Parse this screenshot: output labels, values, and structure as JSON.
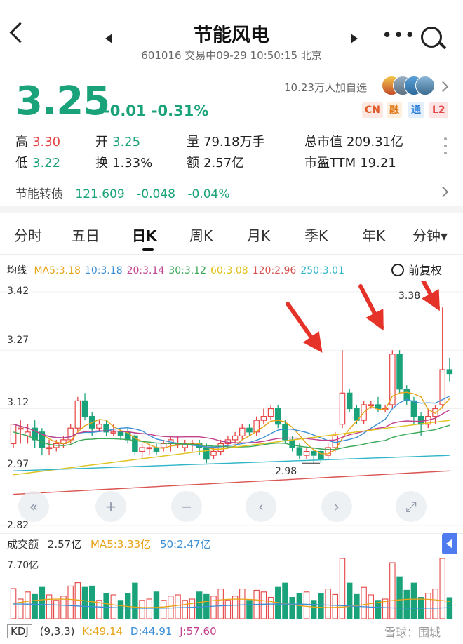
{
  "header": {
    "title": "节能风电",
    "subtitle": "601016 交易中09-29 10:50:15 北京",
    "more": "•••"
  },
  "quote": {
    "price": "3.25",
    "change": "-0.01 -0.31%",
    "follow_text": "10.23万人加自选",
    "badges": [
      "CN",
      "融",
      "通",
      "L2"
    ]
  },
  "stats": {
    "high_label": "高",
    "high": "3.30",
    "open_label": "开",
    "open": "3.25",
    "volume_label": "量",
    "volume": "79.18万手",
    "mcap_label": "总市值",
    "mcap": "209.31亿",
    "low_label": "低",
    "low": "3.22",
    "turnover_label": "换",
    "turnover": "1.33%",
    "amount_label": "额",
    "amount": "2.57亿",
    "pe_label": "市盈TTM",
    "pe": "19.21"
  },
  "bond": {
    "name": "节能转债",
    "price": "121.609",
    "change": "-0.048",
    "pct": "-0.04%"
  },
  "tabs": [
    "分时",
    "五日",
    "日K",
    "周K",
    "月K",
    "季K",
    "年K",
    "分钟▾"
  ],
  "ma_line": {
    "label": "均线",
    "items": [
      {
        "text": "MA5:3.18",
        "color": "#e8a317"
      },
      {
        "text": "10:3.18",
        "color": "#3b8fd6"
      },
      {
        "text": "20:3.14",
        "color": "#c2418f"
      },
      {
        "text": "30:3.12",
        "color": "#3aa857"
      },
      {
        "text": "60:3.08",
        "color": "#e0c21a"
      },
      {
        "text": "120:2.96",
        "color": "#d9534f"
      },
      {
        "text": "250:3.01",
        "color": "#30b5c8"
      }
    ],
    "restore": "前复权"
  },
  "chart_data": {
    "type": "candlestick",
    "y_ticks": [
      "3.42",
      "3.27",
      "3.12",
      "2.97",
      "2.82"
    ],
    "ylim": [
      2.82,
      3.42
    ],
    "annot_high": "3.38",
    "annot_low": "2.98",
    "candles": [
      [
        3.03,
        3.08,
        3.08,
        3.02
      ],
      [
        3.07,
        3.07,
        3.09,
        3.03
      ],
      [
        3.05,
        3.06,
        3.08,
        3.03
      ],
      [
        3.07,
        3.04,
        3.09,
        3.02
      ],
      [
        3.06,
        3.02,
        3.07,
        3.0
      ],
      [
        3.02,
        3.02,
        3.04,
        3.0
      ],
      [
        3.02,
        3.03,
        3.04,
        3.01
      ],
      [
        3.03,
        3.04,
        3.05,
        3.02
      ],
      [
        3.04,
        3.07,
        3.08,
        3.03
      ],
      [
        3.07,
        3.14,
        3.15,
        3.06
      ],
      [
        3.14,
        3.1,
        3.16,
        3.09
      ],
      [
        3.1,
        3.07,
        3.11,
        3.05
      ],
      [
        3.07,
        3.08,
        3.09,
        3.06
      ],
      [
        3.08,
        3.06,
        3.09,
        3.05
      ],
      [
        3.06,
        3.06,
        3.08,
        3.05
      ],
      [
        3.06,
        3.05,
        3.07,
        3.04
      ],
      [
        3.06,
        3.04,
        3.07,
        3.03
      ],
      [
        3.05,
        3.01,
        3.06,
        3.0
      ],
      [
        3.01,
        3.02,
        3.03,
        2.99
      ],
      [
        3.02,
        3.02,
        3.03,
        3.0
      ],
      [
        3.02,
        3.01,
        3.03,
        3.0
      ],
      [
        3.02,
        3.03,
        3.04,
        3.01
      ],
      [
        3.03,
        3.04,
        3.05,
        3.01
      ],
      [
        3.03,
        3.03,
        3.05,
        3.02
      ],
      [
        3.02,
        3.03,
        3.04,
        3.01
      ],
      [
        3.03,
        3.03,
        3.04,
        3.01
      ],
      [
        3.03,
        3.02,
        3.04,
        3.0
      ],
      [
        3.02,
        2.99,
        3.03,
        2.98
      ],
      [
        3.0,
        3.01,
        3.02,
        2.99
      ],
      [
        3.01,
        3.03,
        3.04,
        3.0
      ],
      [
        3.03,
        3.04,
        3.05,
        3.02
      ],
      [
        3.04,
        3.05,
        3.06,
        3.03
      ],
      [
        3.05,
        3.07,
        3.08,
        3.04
      ],
      [
        3.07,
        3.06,
        3.08,
        3.05
      ],
      [
        3.06,
        3.09,
        3.1,
        3.05
      ],
      [
        3.09,
        3.1,
        3.12,
        3.08
      ],
      [
        3.1,
        3.12,
        3.13,
        3.09
      ],
      [
        3.12,
        3.08,
        3.13,
        3.07
      ],
      [
        3.08,
        3.04,
        3.09,
        3.03
      ],
      [
        3.04,
        3.02,
        3.05,
        3.01
      ],
      [
        3.02,
        3.0,
        3.03,
        2.99
      ],
      [
        3.0,
        3.01,
        3.02,
        2.99
      ],
      [
        3.01,
        3.0,
        3.02,
        2.98
      ],
      [
        3.01,
        2.99,
        3.02,
        2.98
      ],
      [
        3.0,
        3.02,
        3.03,
        2.99
      ],
      [
        3.02,
        3.05,
        3.06,
        3.01
      ],
      [
        3.08,
        3.16,
        3.27,
        3.07
      ],
      [
        3.16,
        3.12,
        3.17,
        3.11
      ],
      [
        3.12,
        3.09,
        3.13,
        3.08
      ],
      [
        3.09,
        3.13,
        3.14,
        3.08
      ],
      [
        3.13,
        3.13,
        3.14,
        3.12
      ],
      [
        3.13,
        3.12,
        3.15,
        3.11
      ],
      [
        3.12,
        3.12,
        3.13,
        3.11
      ],
      [
        3.13,
        3.26,
        3.27,
        3.12
      ],
      [
        3.26,
        3.17,
        3.27,
        3.16
      ],
      [
        3.17,
        3.14,
        3.18,
        3.13
      ],
      [
        3.14,
        3.1,
        3.15,
        3.08
      ],
      [
        3.1,
        3.08,
        3.11,
        3.05
      ],
      [
        3.08,
        3.1,
        3.12,
        3.07
      ],
      [
        3.1,
        3.12,
        3.13,
        3.08
      ],
      [
        3.13,
        3.22,
        3.38,
        3.12
      ],
      [
        3.22,
        3.21,
        3.25,
        3.19
      ]
    ]
  },
  "controls": [
    "«",
    "+",
    "−",
    "‹",
    "›",
    "⤢"
  ],
  "volume": {
    "label": "成交额",
    "value": "2.57亿",
    "ma5": "MA5:3.33亿",
    "ma50": "50:2.47亿",
    "ymax_label": "7.70亿"
  },
  "kdj": {
    "label": "KDJ",
    "params": "(9,3,3)",
    "k": "K:49.14",
    "d": "D:44.91",
    "j": "J:57.60"
  },
  "watermark": "雪球：围城",
  "colors": {
    "up": "#e64545",
    "down": "#1aa37a",
    "accent": "#4e7cf0"
  }
}
